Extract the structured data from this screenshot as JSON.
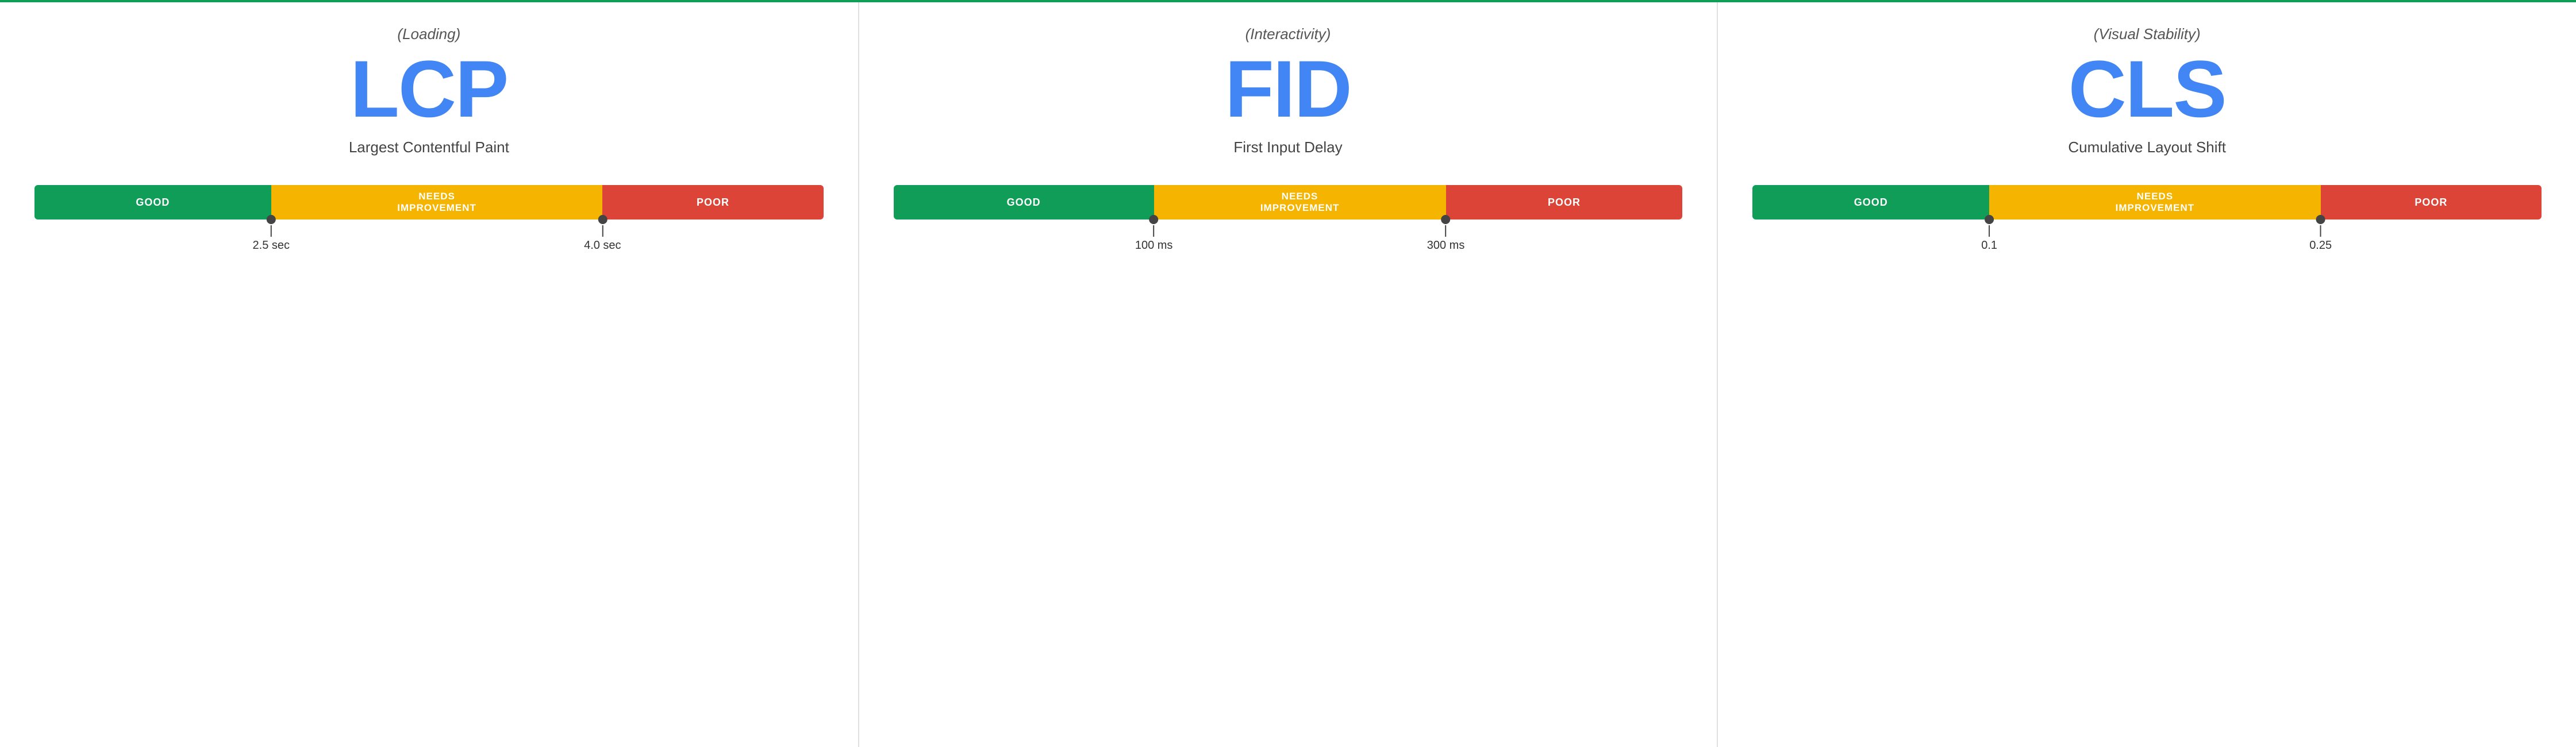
{
  "panels": [
    {
      "id": "lcp",
      "subtitle": "(Loading)",
      "title": "LCP",
      "name": "Largest Contentful Paint",
      "bar": {
        "good_label": "GOOD",
        "needs_label": "NEEDS\nIMPROVEMENT",
        "poor_label": "POOR",
        "good_pct": 30,
        "needs_pct": 42,
        "poor_pct": 28
      },
      "markers": [
        {
          "pct": 30,
          "label": "2.5 sec"
        },
        {
          "pct": 72,
          "label": "4.0 sec"
        }
      ]
    },
    {
      "id": "fid",
      "subtitle": "(Interactivity)",
      "title": "FID",
      "name": "First Input Delay",
      "bar": {
        "good_label": "GOOD",
        "needs_label": "NEEDS\nIMPROVEMENT",
        "poor_label": "POOR",
        "good_pct": 33,
        "needs_pct": 37,
        "poor_pct": 30
      },
      "markers": [
        {
          "pct": 33,
          "label": "100 ms"
        },
        {
          "pct": 70,
          "label": "300 ms"
        }
      ]
    },
    {
      "id": "cls",
      "subtitle": "(Visual Stability)",
      "title": "CLS",
      "name": "Cumulative Layout Shift",
      "bar": {
        "good_label": "GOOD",
        "needs_label": "NEEDS\nIMPROVEMENT",
        "poor_label": "POOR",
        "good_pct": 30,
        "needs_pct": 42,
        "poor_pct": 28
      },
      "markers": [
        {
          "pct": 30,
          "label": "0.1"
        },
        {
          "pct": 72,
          "label": "0.25"
        }
      ]
    }
  ]
}
